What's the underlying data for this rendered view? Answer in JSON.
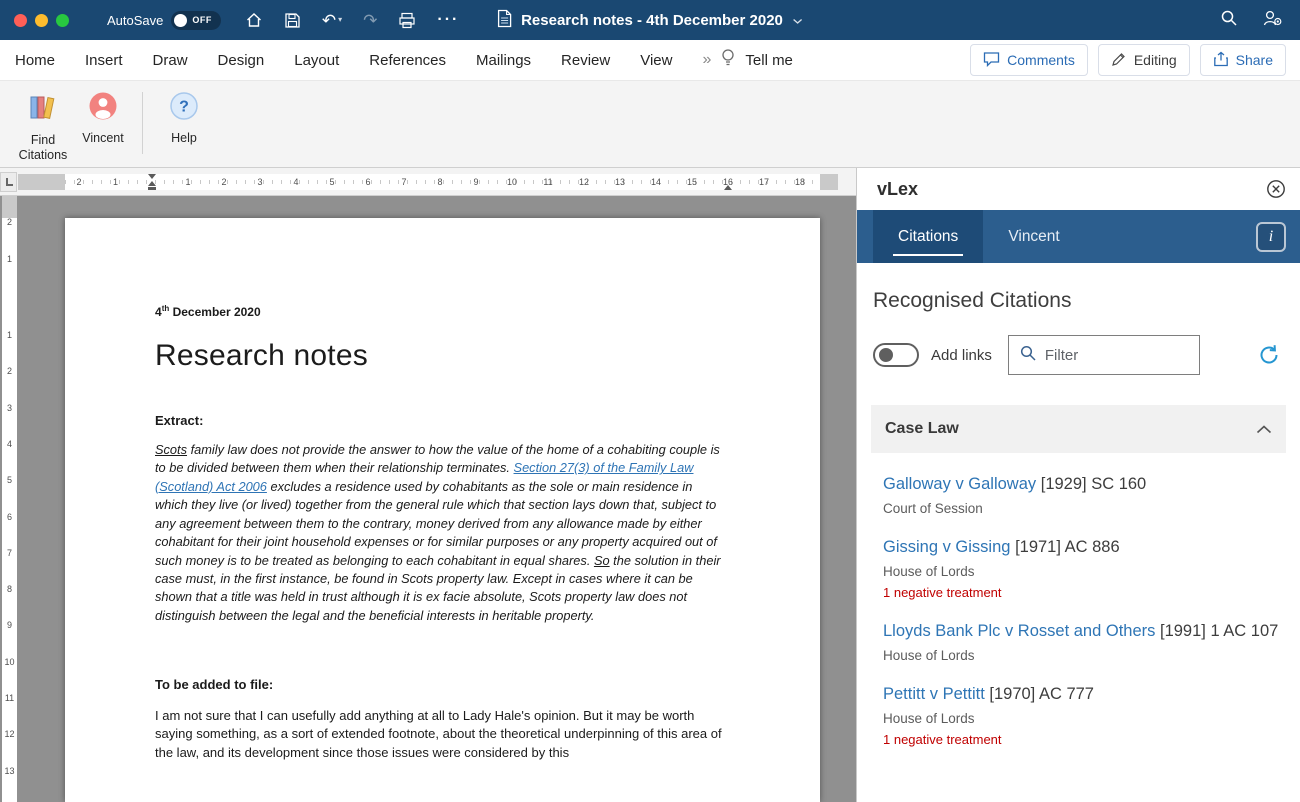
{
  "colors": {
    "titlebar_blue": "#1A4872",
    "panel_blue": "#2C5E8E",
    "active_tab_blue": "#1E4B77",
    "link_blue": "#2E75B5",
    "negative_red": "#C00000"
  },
  "icons": {
    "undo": "↶",
    "redo": "↷",
    "overflow": "···",
    "menu_overflow": "»"
  },
  "titlebar": {
    "autosave_label": "AutoSave",
    "autosave_state": "OFF",
    "doc_title": "Research notes - 4th December 2020"
  },
  "menu": {
    "tabs": [
      "Home",
      "Insert",
      "Draw",
      "Design",
      "Layout",
      "References",
      "Mailings",
      "Review",
      "View"
    ],
    "tell_me": "Tell me",
    "comments": "Comments",
    "editing": "Editing",
    "share": "Share"
  },
  "ribbon": {
    "find_citations": "Find Citations",
    "vincent": "Vincent",
    "help": "Help"
  },
  "ruler": {
    "h_numbers": [
      "2",
      "1",
      "1",
      "2",
      "3",
      "4",
      "5",
      "6",
      "7",
      "8",
      "9",
      "10",
      "11",
      "12",
      "13",
      "14",
      "15",
      "16",
      "17",
      "18"
    ],
    "v_numbers": [
      "2",
      "1",
      "1",
      "2",
      "3",
      "4",
      "5",
      "6",
      "7",
      "8",
      "9",
      "10",
      "11",
      "12",
      "13"
    ]
  },
  "document": {
    "date_num": "4",
    "date_sup": "th",
    "date_rest": " December 2020",
    "title": "Research notes",
    "extract_label": "Extract:",
    "extract": {
      "s1": "Scots",
      "s2": " family law does not provide the answer to how the value of the home of a cohabiting couple is to be divided between them when their relationship terminates. ",
      "link": "Section 27(3) of the Family Law (Scotland) Act 2006",
      "s3": " excludes a residence used by cohabitants as the sole or main residence in which they live (or lived) together from the general rule which that section lays down that, subject to any agreement between them to the contrary, money derived from any allowance made by either cohabitant for their joint household expenses or for similar purposes or any property acquired out of such money is to be treated as belonging to each cohabitant in equal shares. ",
      "s4": "So",
      "s5": " the solution in their case must, in the first instance, be found in Scots property law. Except in cases where it can be shown that a title was held in trust although it is ex facie absolute, Scots property law does not distinguish between the legal and the beneficial interests in heritable property."
    },
    "file_label": "To be added to file:",
    "body": "I am not sure that I can usefully add anything at all to Lady Hale's opinion. But it may be worth saying something, as a sort of extended footnote, about the theoretical underpinning of this area of the law, and its development since those issues were considered by this"
  },
  "vlex": {
    "title": "vLex",
    "tabs": [
      "Citations",
      "Vincent"
    ],
    "info": "i",
    "heading": "Recognised Citations",
    "add_links_label": "Add links",
    "filter_placeholder": "Filter",
    "section_label": "Case Law",
    "citations": [
      {
        "name": "Galloway v Galloway",
        "cite": "[1929] SC 160",
        "court": "Court of Session"
      },
      {
        "name": "Gissing v Gissing",
        "cite": "[1971] AC 886",
        "court": "House of Lords",
        "treatment": "1 negative treatment"
      },
      {
        "name": "Lloyds Bank Plc v Rosset and Others",
        "cite": "[1991] 1 AC 107",
        "court": "House of Lords"
      },
      {
        "name": "Pettitt v Pettitt",
        "cite": "[1970] AC 777",
        "court": "House of Lords",
        "treatment": "1 negative treatment"
      }
    ]
  }
}
